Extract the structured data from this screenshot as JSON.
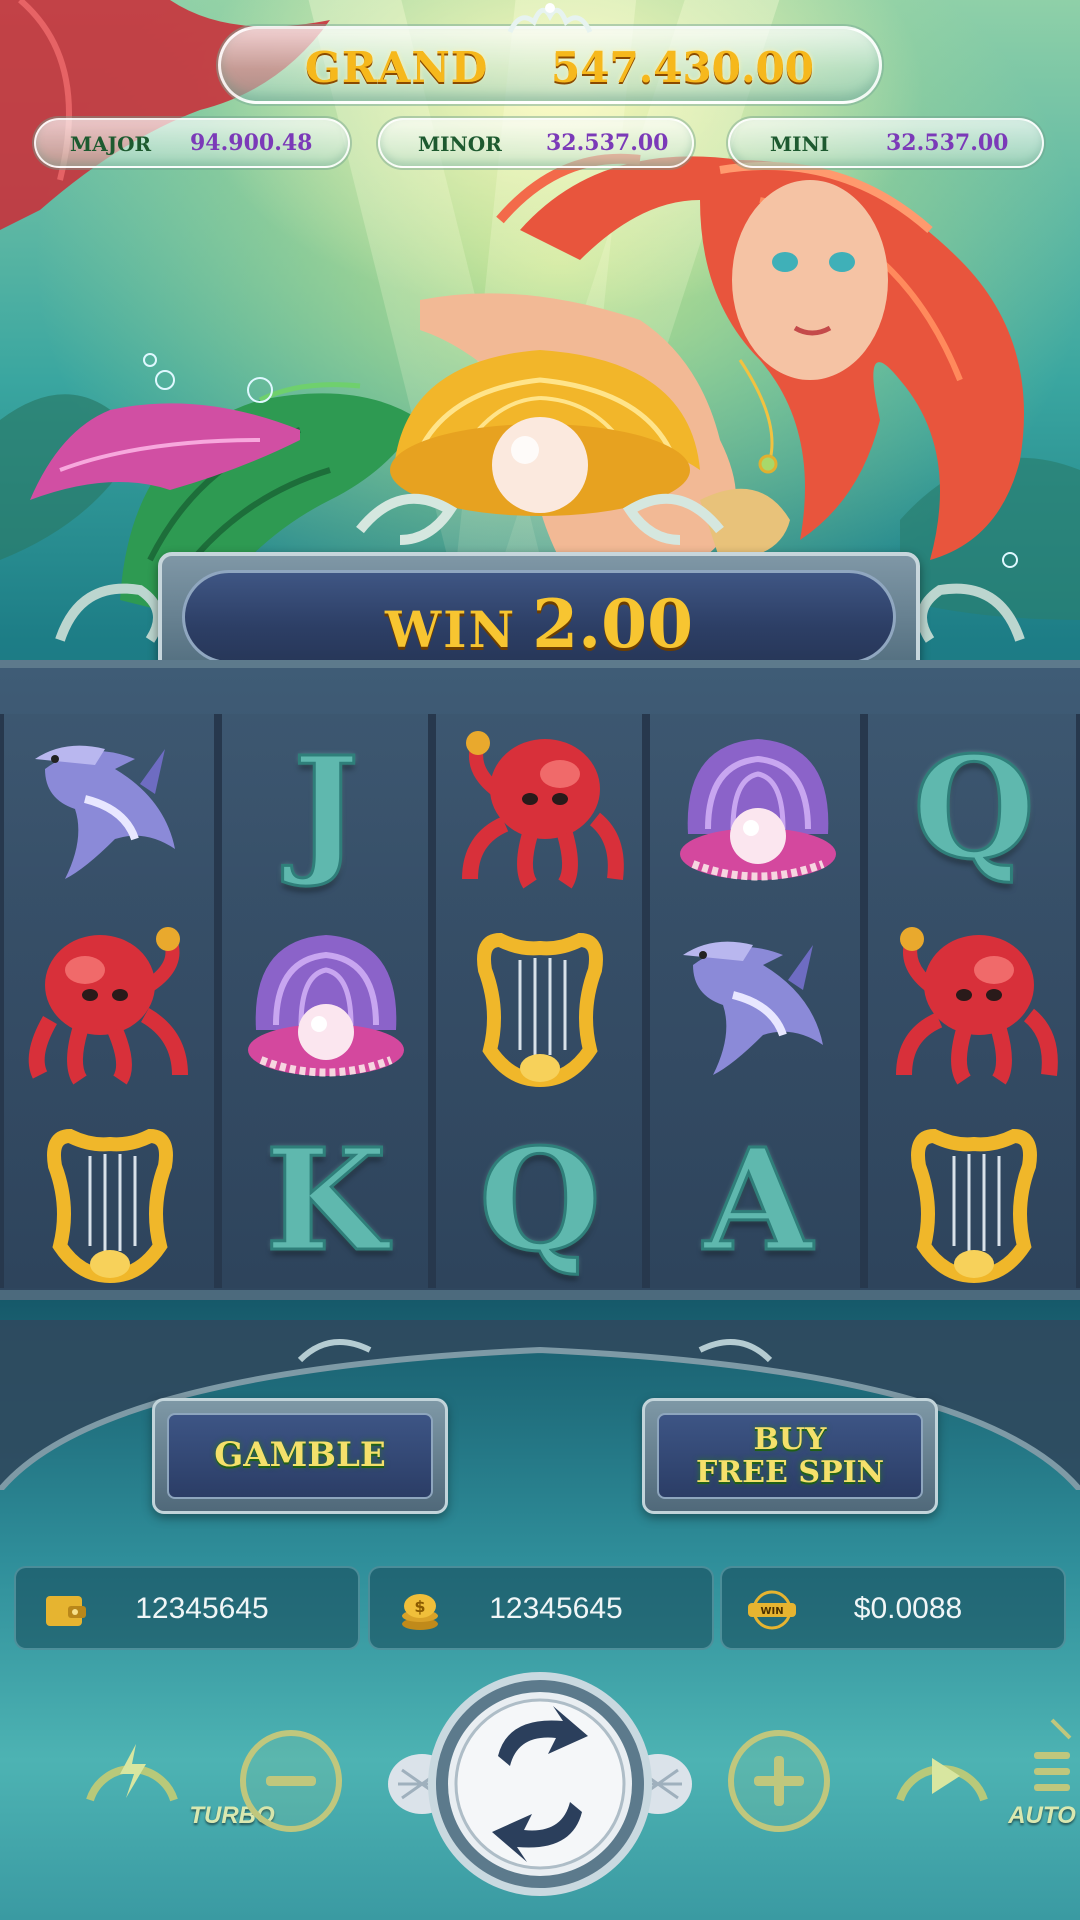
{
  "jackpots": {
    "grand": {
      "label": "GRAND",
      "value": "547.430.00"
    },
    "major": {
      "label": "MAJOR",
      "value": "94.900.48"
    },
    "minor": {
      "label": "MINOR",
      "value": "32.537.00"
    },
    "mini": {
      "label": "MINI",
      "value": "32.537.00"
    }
  },
  "win": {
    "label": "WIN",
    "amount": "2.00"
  },
  "reels": {
    "columns": [
      [
        "hammerhead-shark",
        "octopus",
        "golden-harp"
      ],
      [
        "J",
        "pearl-shell",
        "K"
      ],
      [
        "octopus",
        "golden-harp",
        "Q"
      ],
      [
        "pearl-shell",
        "hammerhead-shark",
        "A"
      ],
      [
        "Q",
        "octopus",
        "golden-harp"
      ]
    ]
  },
  "buttons": {
    "gamble": "GAMBLE",
    "buy_line1": "BUY",
    "buy_line2": "FREE SPIN"
  },
  "stats": {
    "balance": {
      "icon": "wallet-icon",
      "value": "12345645"
    },
    "bet": {
      "icon": "coin-stack-icon",
      "value": "12345645"
    },
    "last_win": {
      "icon": "win-badge-icon",
      "badge": "WIN",
      "value": "$0.0088"
    }
  },
  "controls": {
    "turbo": "TURBO",
    "auto": "AUTO"
  },
  "colors": {
    "gold_text": "#f6b81c",
    "win_banner_bg": "#2d3f66",
    "reel_bg": "#364f68",
    "button_text": "#f5e06b"
  }
}
